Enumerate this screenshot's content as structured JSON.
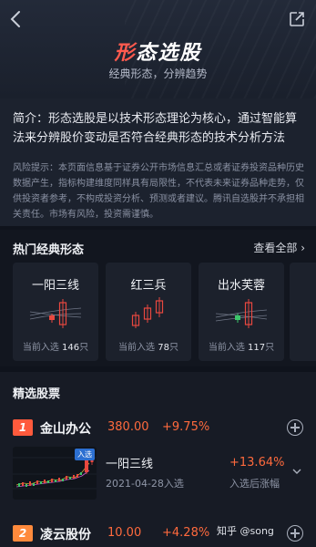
{
  "header": {
    "title_accent": "形",
    "title_rest": "态选股",
    "subtitle": "经典形态，分辨趋势"
  },
  "intro": {
    "text": "简介：形态选股是以技术形态理论为核心，通过智能算法来分辨股价变动是否符合经典形态的技术分析方法",
    "risk": "风险提示：本页面信息基于证券公开市场信息汇总或者证券投资品种历史数据产生，指标构建维度同样具有局限性，不代表未来证券品种走势，仅供投资者参考，不构成投资分析、预测或者建议。腾讯自选股并不承担相关责任。市场有风险，投资需谨慎。"
  },
  "hot": {
    "title": "热门经典形态",
    "see_all": "查看全部",
    "count_prefix": "当前入选",
    "count_suffix": "只",
    "cards": [
      {
        "name": "一阳三线",
        "count": "146"
      },
      {
        "name": "红三兵",
        "count": "78"
      },
      {
        "name": "出水芙蓉",
        "count": "117"
      }
    ]
  },
  "stocks": {
    "title": "精选股票",
    "items": [
      {
        "rank": "1",
        "name": "金山办公",
        "price": "380.00",
        "change": "+9.75%",
        "chart_tag": "入选",
        "pattern": "一阳三线",
        "date": "2021-04-28入选",
        "gain": "+13.64%",
        "gain_label": "入选后涨幅"
      },
      {
        "rank": "2",
        "name": "凌云股份",
        "price": "10.00",
        "change": "+4.28%"
      }
    ]
  },
  "watermark": "知乎 @song",
  "colors": {
    "accent": "#ff5a4e",
    "rise": "#ff6a3d",
    "rank1": "#ff5a3c",
    "rank2": "#ff8a3c"
  }
}
